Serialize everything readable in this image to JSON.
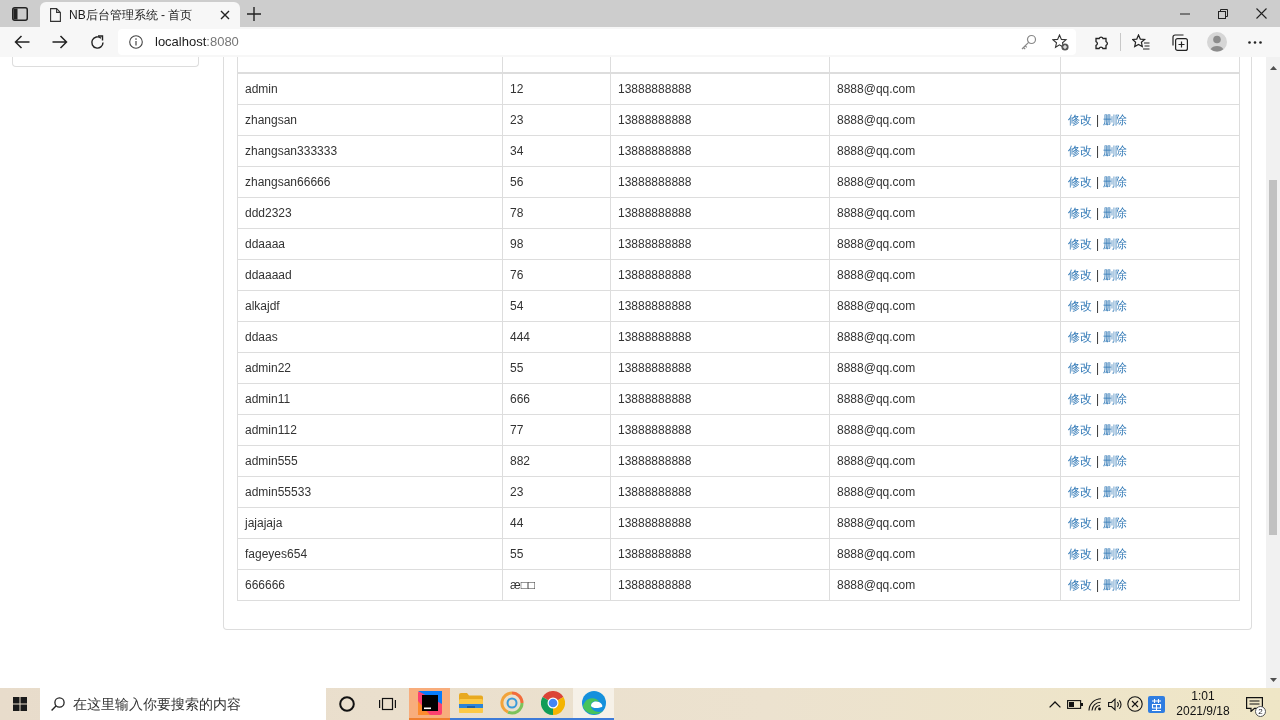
{
  "browser": {
    "tab": {
      "title": "NB后台管理系统 - 首页"
    },
    "address": {
      "host": "localhost",
      "port": ":8080"
    }
  },
  "table": {
    "rows": [
      {
        "cells": [
          "admin",
          "12",
          "13888888888",
          "8888@qq.com"
        ]
      },
      {
        "cells": [
          "zhangsan",
          "23",
          "13888888888",
          "8888@qq.com"
        ],
        "actions": {
          "edit": "修改",
          "separator": "|",
          "delete": "删除"
        }
      },
      {
        "cells": [
          "zhangsan333333",
          "34",
          "13888888888",
          "8888@qq.com"
        ],
        "actions": {
          "edit": "修改",
          "separator": "|",
          "delete": "删除"
        }
      },
      {
        "cells": [
          "zhangsan66666",
          "56",
          "13888888888",
          "8888@qq.com"
        ],
        "actions": {
          "edit": "修改",
          "separator": "|",
          "delete": "删除"
        }
      },
      {
        "cells": [
          "ddd2323",
          "78",
          "13888888888",
          "8888@qq.com"
        ],
        "actions": {
          "edit": "修改",
          "separator": "|",
          "delete": "删除"
        }
      },
      {
        "cells": [
          "ddaaaa",
          "98",
          "13888888888",
          "8888@qq.com"
        ],
        "actions": {
          "edit": "修改",
          "separator": "|",
          "delete": "删除"
        }
      },
      {
        "cells": [
          "ddaaaad",
          "76",
          "13888888888",
          "8888@qq.com"
        ],
        "actions": {
          "edit": "修改",
          "separator": "|",
          "delete": "删除"
        }
      },
      {
        "cells": [
          "alkajdf",
          "54",
          "13888888888",
          "8888@qq.com"
        ],
        "actions": {
          "edit": "修改",
          "separator": "|",
          "delete": "删除"
        }
      },
      {
        "cells": [
          "ddaas",
          "444",
          "13888888888",
          "8888@qq.com"
        ],
        "actions": {
          "edit": "修改",
          "separator": "|",
          "delete": "删除"
        }
      },
      {
        "cells": [
          "admin22",
          "55",
          "13888888888",
          "8888@qq.com"
        ],
        "actions": {
          "edit": "修改",
          "separator": "|",
          "delete": "删除"
        }
      },
      {
        "cells": [
          "admin11",
          "666",
          "13888888888",
          "8888@qq.com"
        ],
        "actions": {
          "edit": "修改",
          "separator": "|",
          "delete": "删除"
        }
      },
      {
        "cells": [
          "admin112",
          "77",
          "13888888888",
          "8888@qq.com"
        ],
        "actions": {
          "edit": "修改",
          "separator": "|",
          "delete": "删除"
        }
      },
      {
        "cells": [
          "admin555",
          "882",
          "13888888888",
          "8888@qq.com"
        ],
        "actions": {
          "edit": "修改",
          "separator": "|",
          "delete": "删除"
        }
      },
      {
        "cells": [
          "admin55533",
          "23",
          "13888888888",
          "8888@qq.com"
        ],
        "actions": {
          "edit": "修改",
          "separator": "|",
          "delete": "删除"
        }
      },
      {
        "cells": [
          "jajajaja",
          "44",
          "13888888888",
          "8888@qq.com"
        ],
        "actions": {
          "edit": "修改",
          "separator": "|",
          "delete": "删除"
        }
      },
      {
        "cells": [
          "fageyes654",
          "55",
          "13888888888",
          "8888@qq.com"
        ],
        "actions": {
          "edit": "修改",
          "separator": "|",
          "delete": "删除"
        }
      },
      {
        "cells": [
          "666666",
          "æ□□",
          "13888888888",
          "8888@qq.com"
        ],
        "actions": {
          "edit": "修改",
          "separator": "|",
          "delete": "删除"
        }
      }
    ]
  },
  "taskbar": {
    "search": {
      "placeholder": "在这里输入你要搜索的内容"
    },
    "apps": [
      {
        "kind": "ide",
        "open": true,
        "active": false,
        "flashing": true
      },
      {
        "kind": "files",
        "open": true,
        "active": false,
        "flashing": false
      },
      {
        "kind": "swirl",
        "open": true,
        "active": false,
        "flashing": false
      },
      {
        "kind": "ring",
        "open": true,
        "active": false,
        "flashing": false
      },
      {
        "kind": "wave",
        "open": true,
        "active": true,
        "flashing": false
      }
    ],
    "clock": {
      "time": "1:01",
      "date": "2021/9/18"
    },
    "notifications": {
      "count": "2"
    }
  }
}
